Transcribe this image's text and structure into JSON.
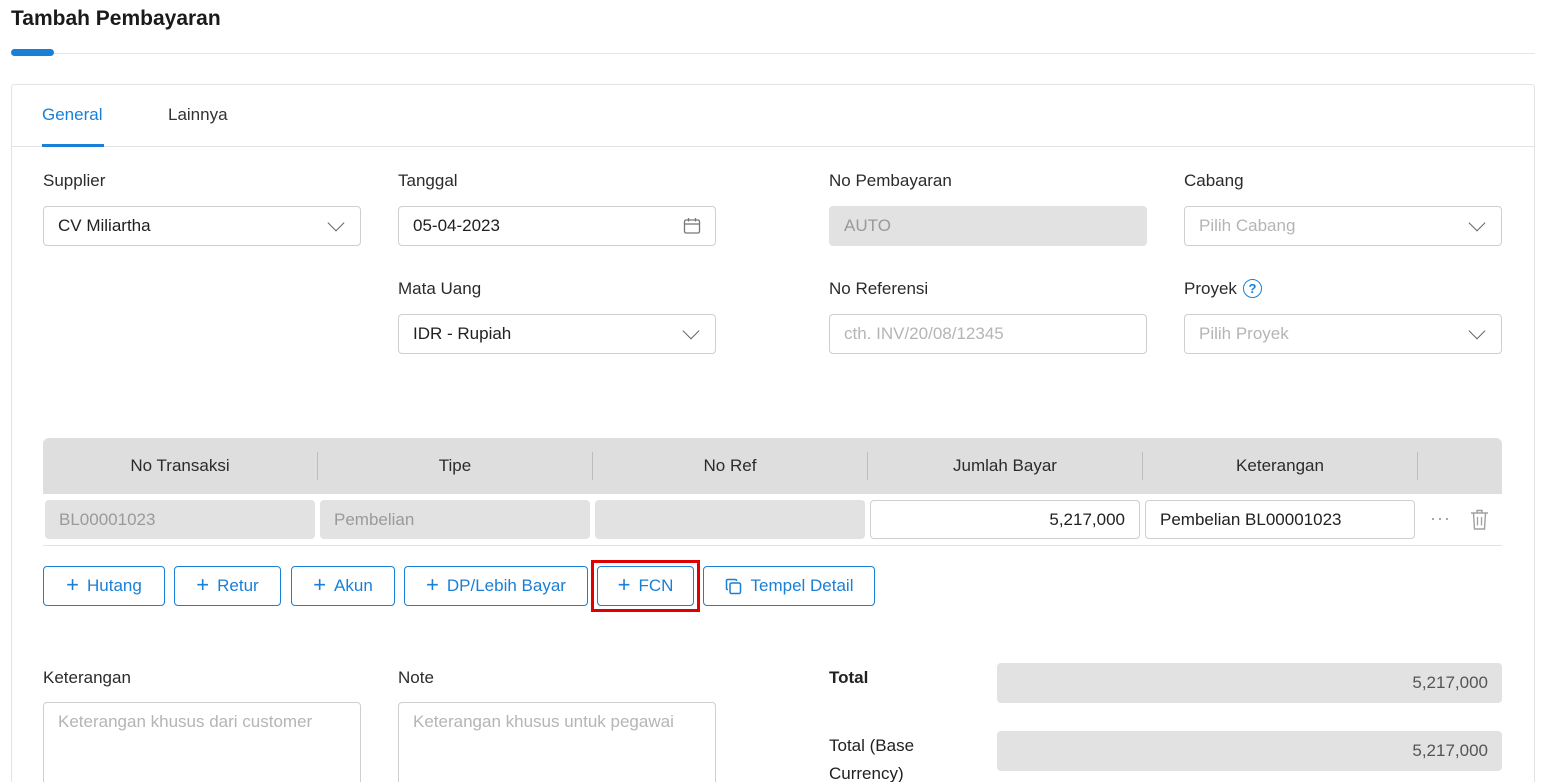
{
  "page": {
    "title": "Tambah Pembayaran"
  },
  "tabs": [
    {
      "label": "General",
      "active": true
    },
    {
      "label": "Lainnya",
      "active": false
    }
  ],
  "form": {
    "supplier": {
      "label": "Supplier",
      "value": "CV Miliartha"
    },
    "tanggal": {
      "label": "Tanggal",
      "value": "05-04-2023",
      "icon": "calendar-icon"
    },
    "no_pembayaran": {
      "label": "No Pembayaran",
      "value": "AUTO"
    },
    "cabang": {
      "label": "Cabang",
      "placeholder": "Pilih Cabang"
    },
    "mata_uang": {
      "label": "Mata Uang",
      "value": "IDR - Rupiah"
    },
    "no_referensi": {
      "label": "No Referensi",
      "placeholder": "cth. INV/20/08/12345"
    },
    "proyek": {
      "label": "Proyek",
      "placeholder": "Pilih Proyek",
      "help_glyph": "?"
    }
  },
  "table": {
    "columns": [
      "No Transaksi",
      "Tipe",
      "No Ref",
      "Jumlah Bayar",
      "Keterangan"
    ],
    "rows": [
      {
        "no_transaksi": "BL00001023",
        "tipe": "Pembelian",
        "no_ref": "",
        "jumlah_bayar": "5,217,000",
        "keterangan": "Pembelian BL00001023",
        "more": "···"
      }
    ]
  },
  "actions": {
    "hutang": "Hutang",
    "retur": "Retur",
    "akun": "Akun",
    "dp": "DP/Lebih Bayar",
    "fcn": "FCN",
    "tempel": "Tempel Detail",
    "plus_glyph": "+"
  },
  "footer": {
    "keterangan": {
      "label": "Keterangan",
      "placeholder": "Keterangan khusus dari customer"
    },
    "note": {
      "label": "Note",
      "placeholder": "Keterangan khusus untuk pegawai"
    },
    "total": {
      "label": "Total",
      "value": "5,217,000"
    },
    "total_base": {
      "label_line1": "Total (Base",
      "label_line2": "Currency)",
      "value": "5,217,000"
    }
  },
  "colors": {
    "accent": "#1a7fd6",
    "highlight": "#e00000",
    "disabled_bg": "#e2e2e2",
    "table_header_bg": "#dedede"
  }
}
